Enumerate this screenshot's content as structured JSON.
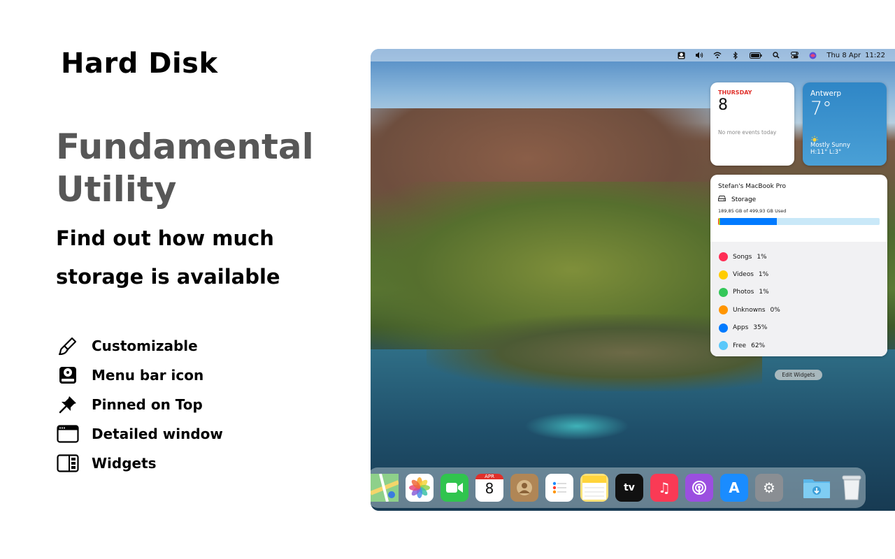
{
  "promo": {
    "app_title": "Hard Disk",
    "headline_line1": "Fundamental",
    "headline_line2": "Utility",
    "subline": "Find out how much storage is available",
    "features": [
      {
        "label": "Customizable",
        "icon": "paintbrush-icon"
      },
      {
        "label": "Menu bar icon",
        "icon": "hard-disk-icon"
      },
      {
        "label": "Pinned on Top",
        "icon": "pin-icon"
      },
      {
        "label": "Detailed window",
        "icon": "window-icon"
      },
      {
        "label": "Widgets",
        "icon": "widget-icon"
      }
    ]
  },
  "menubar": {
    "icons": [
      "hard-disk-icon",
      "volume-icon",
      "wifi-icon",
      "bluetooth-icon",
      "battery-icon",
      "search-icon",
      "control-center-icon",
      "siri-icon"
    ],
    "date": "Thu 8 Apr",
    "time": "11:22"
  },
  "calendar_widget": {
    "weekday": "THURSDAY",
    "day": "8",
    "events": "No more events today"
  },
  "weather_widget": {
    "city": "Antwerp",
    "temperature": "7°",
    "condition": "Mostly Sunny",
    "hilo": "H:11° L:3°"
  },
  "storage_widget": {
    "device": "Stefan's MacBook Pro",
    "label": "Storage",
    "used_text": "189,85 GB of 499,93 GB Used",
    "bar_segments": [
      {
        "color": "#ff3b30",
        "percent": 0.4
      },
      {
        "color": "#ffcc00",
        "percent": 0.4
      },
      {
        "color": "#34c759",
        "percent": 0.4
      },
      {
        "color": "#ff9500",
        "percent": 0.2
      },
      {
        "color": "#007aff",
        "percent": 35
      }
    ],
    "items": [
      {
        "label": "Songs",
        "value": "1%",
        "color": "#ff2d55"
      },
      {
        "label": "Videos",
        "value": "1%",
        "color": "#ffcc00"
      },
      {
        "label": "Photos",
        "value": "1%",
        "color": "#34c759"
      },
      {
        "label": "Unknowns",
        "value": "0%",
        "color": "#ff9500"
      },
      {
        "label": "Apps",
        "value": "35%",
        "color": "#007aff"
      },
      {
        "label": "Free",
        "value": "62%",
        "color": "#5ac8fa"
      }
    ]
  },
  "edit_widgets_label": "Edit Widgets",
  "dock": {
    "apps": [
      {
        "name": "maps-icon",
        "color": "#5fb36a",
        "glyph": ""
      },
      {
        "name": "photos-icon",
        "color": "#ffffff",
        "glyph": ""
      },
      {
        "name": "facetime-icon",
        "color": "#30c44e",
        "glyph": ""
      },
      {
        "name": "calendar-icon",
        "color": "#ffffff",
        "glyph": "8"
      },
      {
        "name": "contacts-icon",
        "color": "#b08656",
        "glyph": ""
      },
      {
        "name": "reminders-icon",
        "color": "#ffffff",
        "glyph": ""
      },
      {
        "name": "notes-icon",
        "color": "#ffe27a",
        "glyph": ""
      },
      {
        "name": "apple-tv-icon",
        "color": "#111111",
        "glyph": "tv"
      },
      {
        "name": "music-icon",
        "color": "#fa3a55",
        "glyph": "♫"
      },
      {
        "name": "podcasts-icon",
        "color": "#9b4fe0",
        "glyph": ""
      },
      {
        "name": "app-store-icon",
        "color": "#1a8cff",
        "glyph": "A"
      },
      {
        "name": "system-preferences-icon",
        "color": "#8a8e93",
        "glyph": "⚙"
      }
    ],
    "extras": [
      {
        "name": "downloads-folder-icon",
        "color": "#6cc4ef",
        "glyph": "↓"
      },
      {
        "name": "trash-icon",
        "color": "#e8ecef",
        "glyph": ""
      }
    ],
    "calendar_month": "APR"
  }
}
